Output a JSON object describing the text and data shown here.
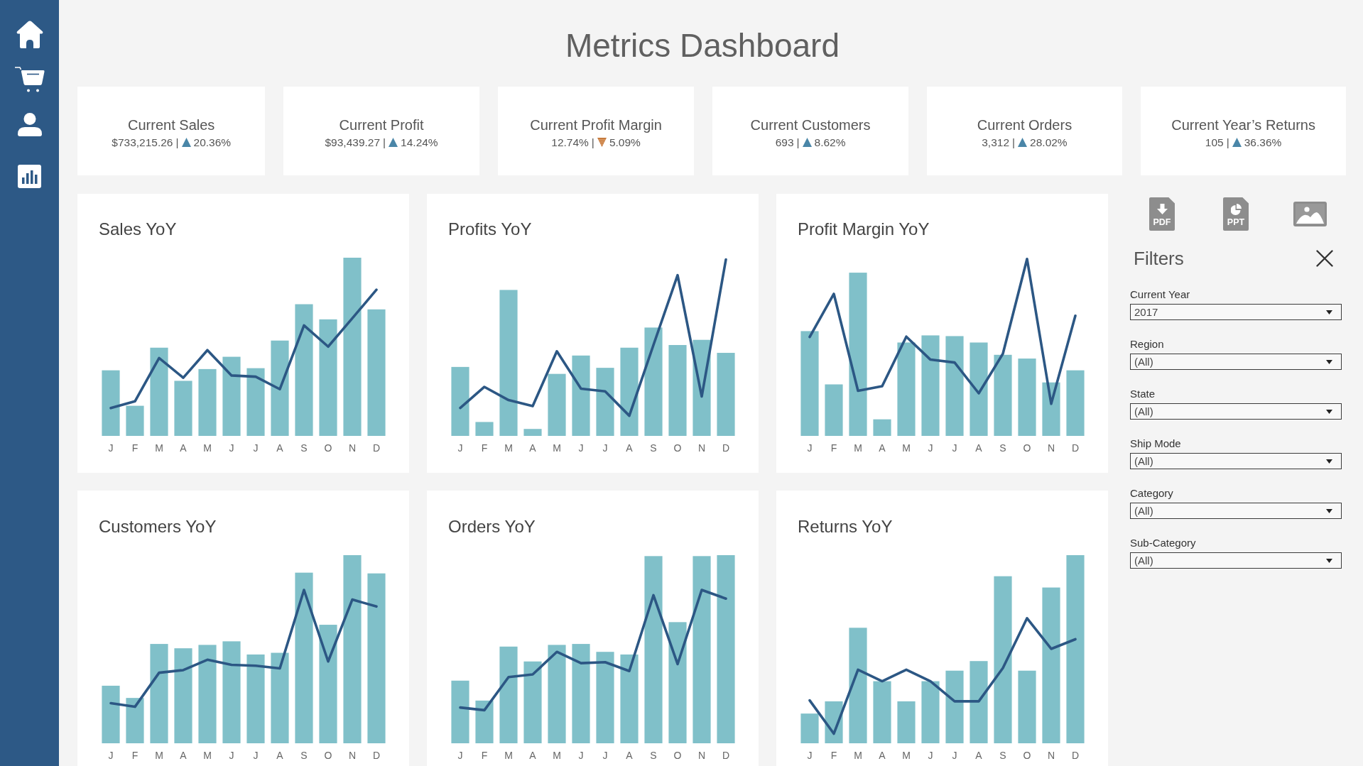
{
  "title": "Metrics Dashboard",
  "kpis": [
    {
      "title": "Current Sales",
      "value": "$733,215.26",
      "separator": "|",
      "rising": true,
      "change": "20.36%"
    },
    {
      "title": "Current Profit",
      "value": "$93,439.27",
      "separator": "|",
      "rising": true,
      "change": "14.24%"
    },
    {
      "title": "Current Profit Margin",
      "value": "12.74%",
      "separator": "|",
      "rising": false,
      "change": "5.09%"
    },
    {
      "title": "Current Customers",
      "value": "693",
      "separator": "|",
      "rising": true,
      "change": "8.62%"
    },
    {
      "title": "Current Orders",
      "value": "3,312",
      "separator": "|",
      "rising": true,
      "change": "28.02%"
    },
    {
      "title": "Current Year’s Returns",
      "value": "105",
      "separator": "|",
      "rising": true,
      "change": "36.36%"
    }
  ],
  "charts": [
    {
      "title": "Sales YoY",
      "month_labels": [
        "J",
        "F",
        "M",
        "A",
        "M",
        "J",
        "J",
        "A",
        "S",
        "O",
        "N",
        "D"
      ]
    },
    {
      "title": "Profits YoY",
      "month_labels": [
        "J",
        "F",
        "M",
        "A",
        "M",
        "J",
        "J",
        "A",
        "S",
        "O",
        "N",
        "D"
      ]
    },
    {
      "title": "Profit Margin YoY",
      "month_labels": [
        "J",
        "F",
        "M",
        "A",
        "M",
        "J",
        "J",
        "A",
        "S",
        "O",
        "N",
        "D"
      ]
    },
    {
      "title": "Customers YoY",
      "month_labels": [
        "J",
        "F",
        "M",
        "A",
        "M",
        "J",
        "J",
        "A",
        "S",
        "O",
        "N",
        "D"
      ]
    },
    {
      "title": "Orders YoY",
      "month_labels": [
        "J",
        "F",
        "M",
        "A",
        "M",
        "J",
        "J",
        "A",
        "S",
        "O",
        "N",
        "D"
      ]
    },
    {
      "title": "Returns YoY",
      "month_labels": [
        "J",
        "F",
        "M",
        "A",
        "M",
        "J",
        "J",
        "A",
        "S",
        "O",
        "N",
        "D"
      ]
    }
  ],
  "export": {
    "pdf_label": "PDF",
    "ppt_label": "PPT"
  },
  "filters": {
    "title": "Filters",
    "fields": [
      {
        "label": "Current Year",
        "value": "2017"
      },
      {
        "label": "Region",
        "value": "(All)"
      },
      {
        "label": "State",
        "value": "(All)"
      },
      {
        "label": "Ship Mode",
        "value": "(All)"
      },
      {
        "label": "Category",
        "value": "(All)"
      },
      {
        "label": "Sub-Category",
        "value": "(All)"
      }
    ]
  }
}
